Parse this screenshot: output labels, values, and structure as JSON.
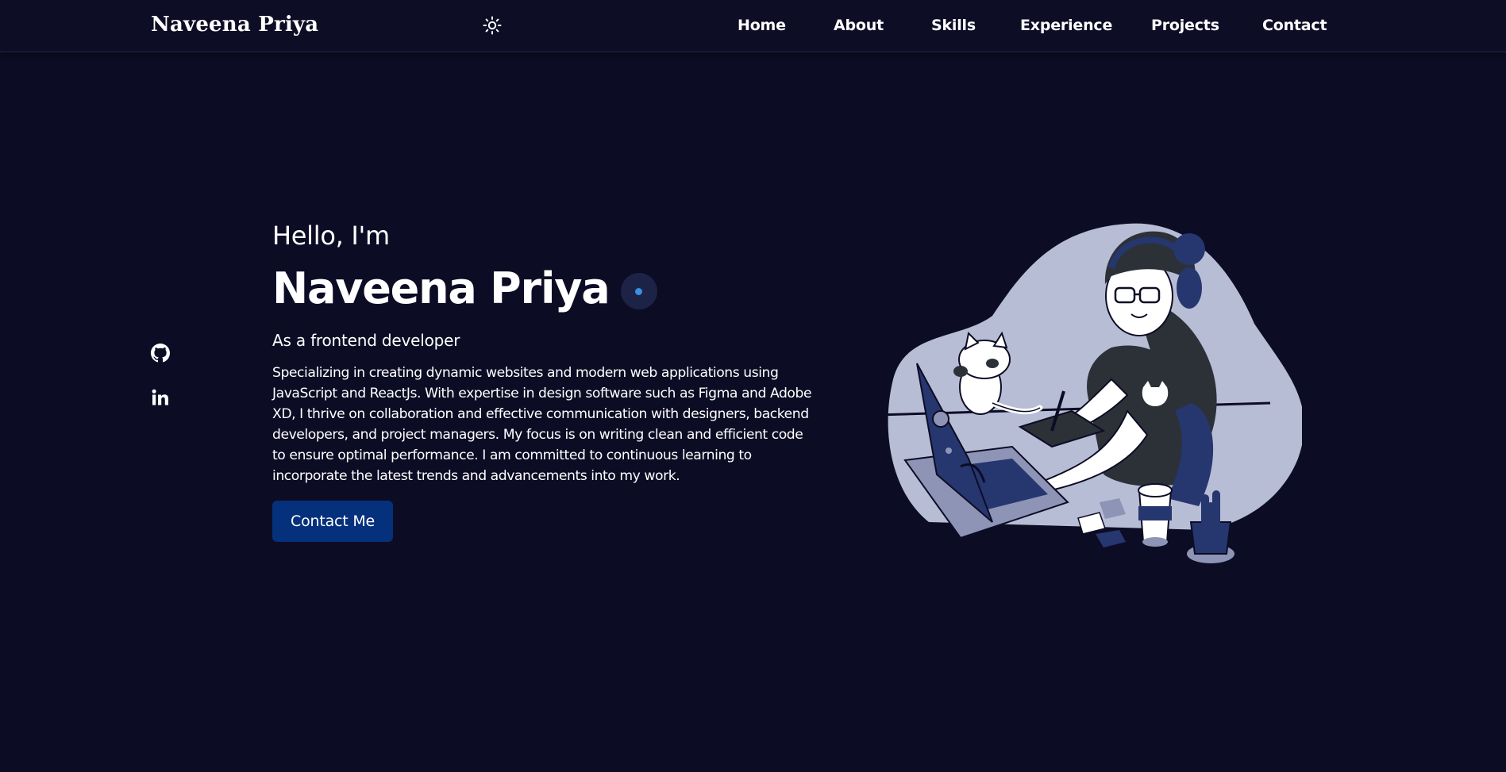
{
  "header": {
    "brand": "Naveena Priya",
    "theme_toggle_icon": "sun-icon",
    "nav": [
      {
        "label": "Home"
      },
      {
        "label": "About"
      },
      {
        "label": "Skills"
      },
      {
        "label": "Experience"
      },
      {
        "label": "Projects"
      },
      {
        "label": "Contact"
      }
    ]
  },
  "social": [
    {
      "icon": "github-icon"
    },
    {
      "icon": "linkedin-icon"
    }
  ],
  "hero": {
    "greeting": "Hello, I'm",
    "name": "Naveena Priya",
    "role": "As a frontend developer",
    "description": "Specializing in creating dynamic websites and modern web applications using JavaScript and ReactJs. With expertise in design software such as Figma and Adobe XD, I thrive on collaboration and effective communication with designers, backend developers, and project managers. My focus is on writing clean and efficient code to ensure optimal performance. I am committed to continuous learning to incorporate the latest trends and advancements into my work.",
    "cta_label": "Contact Me"
  },
  "illustration": {
    "icon": "developer-at-desk-illustration"
  },
  "colors": {
    "background": "#0d0c25",
    "button": "#04307c",
    "accent_dot": "#3d8fe0",
    "illustration_navy": "#26366e",
    "illustration_blob": "#b8bdd6"
  }
}
